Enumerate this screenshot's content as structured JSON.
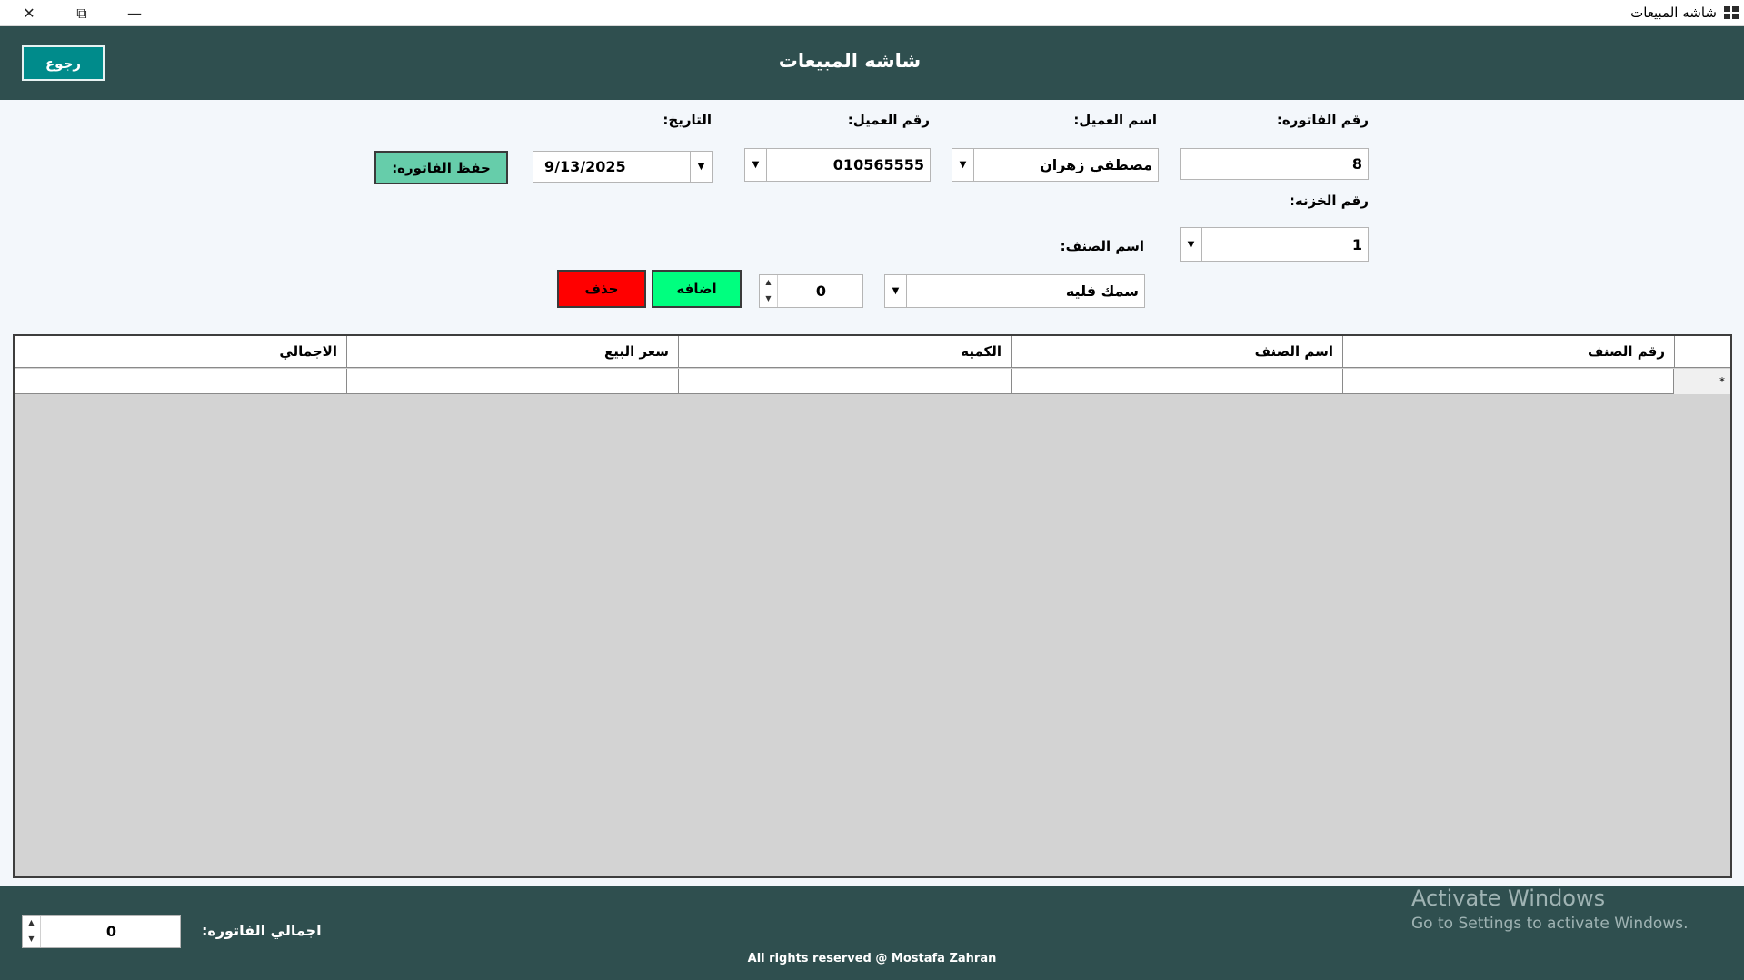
{
  "window": {
    "title": "شاشه المبيعات",
    "close_glyph": "✕",
    "restore_glyph": "⧉",
    "minimize_glyph": "—"
  },
  "header": {
    "title": "شاشه المبيعات",
    "back_label": "رجوع"
  },
  "form": {
    "invoice_no_label": "رقم الفاتوره:",
    "invoice_no_value": "8",
    "customer_name_label": "اسم العميل:",
    "customer_name_value": "مصطفي زهران",
    "customer_no_label": "رقم العميل:",
    "customer_no_value": "010565555",
    "date_label": "التاريخ:",
    "date_value": "9/13/2025",
    "save_label": "حفظ الفاتوره:",
    "safe_no_label": "رقم الخزنه:",
    "safe_no_value": "1",
    "item_name_label": "اسم الصنف:",
    "item_name_value": "سمك فليه",
    "quantity_value": "0",
    "add_label": "اضافه",
    "delete_label": "حذف"
  },
  "grid": {
    "columns": [
      "رقم الصنف",
      "اسم الصنف",
      "الكميه",
      "سعر البيع",
      "الاجمالي"
    ],
    "new_row_marker": "*"
  },
  "footer": {
    "total_label": "اجمالي الفاتوره:",
    "total_value": "0",
    "copyright": "All rights reserved @ Mostafa Zahran",
    "activate_title": "Activate Windows",
    "activate_sub": "Go to Settings to activate Windows."
  },
  "colors": {
    "header_bg": "#2f4f4f",
    "back_btn": "#008b8b",
    "save_btn": "#66cdaa",
    "add_btn": "#00ff7f",
    "delete_btn": "#ff0000"
  }
}
